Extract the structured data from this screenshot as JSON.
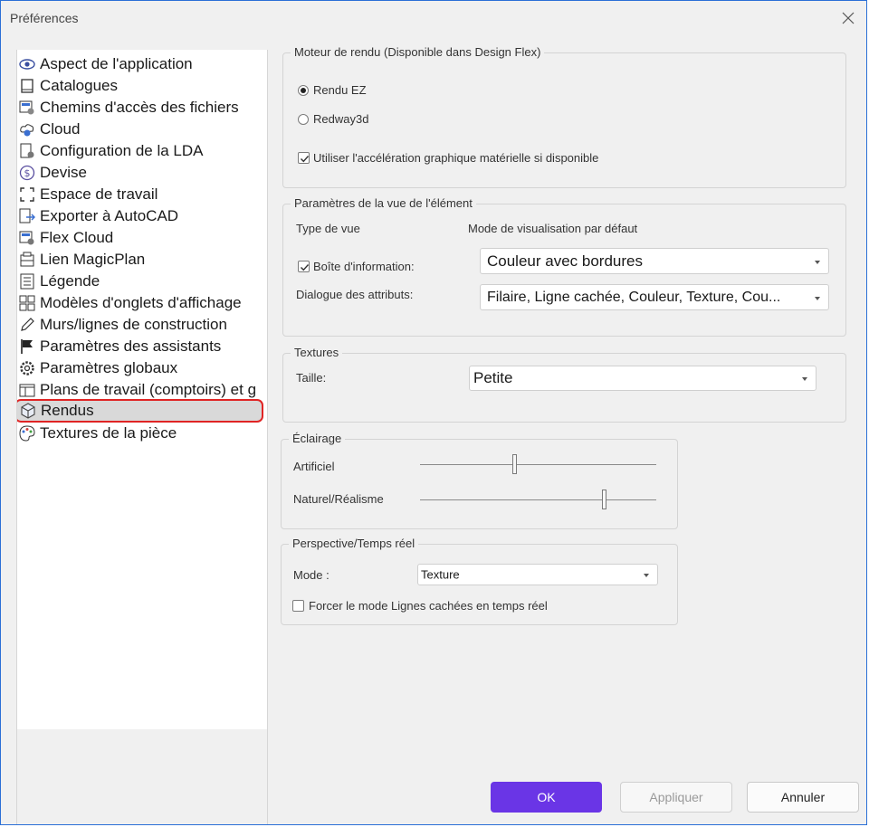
{
  "window": {
    "title": "Préférences"
  },
  "tree": {
    "items": [
      {
        "label": "Aspect de l'application",
        "icon": "eye-icon"
      },
      {
        "label": "Catalogues",
        "icon": "book-icon"
      },
      {
        "label": "Chemins d'accès des fichiers",
        "icon": "folder-gear-icon"
      },
      {
        "label": "Cloud",
        "icon": "cloud-gear-icon"
      },
      {
        "label": "Configuration de la LDA",
        "icon": "document-gear-icon"
      },
      {
        "label": "Devise",
        "icon": "currency-icon"
      },
      {
        "label": "Espace de travail",
        "icon": "workspace-frame-icon"
      },
      {
        "label": "Exporter à AutoCAD",
        "icon": "export-icon"
      },
      {
        "label": "Flex Cloud",
        "icon": "flex-cloud-icon"
      },
      {
        "label": "Lien MagicPlan",
        "icon": "magicplan-icon"
      },
      {
        "label": "Légende",
        "icon": "legend-icon"
      },
      {
        "label": "Modèles d'onglets d'affichage",
        "icon": "tabs-template-icon"
      },
      {
        "label": "Murs/lignes de construction",
        "icon": "pencil-icon"
      },
      {
        "label": "Paramètres des assistants",
        "icon": "flag-icon"
      },
      {
        "label": "Paramètres globaux",
        "icon": "gear-icon"
      },
      {
        "label": "Plans de travail (comptoirs) et g",
        "icon": "countertop-icon"
      },
      {
        "label": "Rendus",
        "icon": "cube-icon"
      },
      {
        "label": "Textures de la pièce",
        "icon": "palette-icon"
      }
    ],
    "selected": "Rendus"
  },
  "render_engine": {
    "title": "Moteur de rendu (Disponible dans Design Flex)",
    "option1": "Rendu EZ",
    "option2": "Redway3d",
    "selected": "Rendu EZ",
    "hw_accel_label": "Utiliser l'accélération graphique matérielle si disponible",
    "hw_accel_checked": true
  },
  "view_params": {
    "title": "Paramètres de la vue de l'élément",
    "col_view_type": "Type de vue",
    "col_default_mode": "Mode de visualisation par défaut",
    "info_box_label": "Boîte d'information:",
    "info_box_checked": true,
    "info_box_value": "Couleur avec bordures",
    "attr_dialog_label": "Dialogue des attributs:",
    "attr_dialog_value": "Filaire, Ligne cachée, Couleur, Texture, Cou..."
  },
  "textures": {
    "title": "Textures",
    "size_label": "Taille:",
    "size_value": "Petite"
  },
  "lighting": {
    "title": "Éclairage",
    "artificial_label": "Artificiel",
    "artificial_level": 0.4,
    "natural_label": "Naturel/Réalisme",
    "natural_level": 0.8
  },
  "perspective": {
    "title": "Perspective/Temps réel",
    "mode_label": "Mode :",
    "mode_value": "Texture",
    "force_hidden_label": "Forcer le mode Lignes cachées en temps réel",
    "force_hidden_checked": false
  },
  "buttons": {
    "ok": "OK",
    "apply": "Appliquer",
    "cancel": "Annuler"
  },
  "colors": {
    "accent": "#6a35e6",
    "selection_border": "#e02424",
    "window_border": "#2b6fd6"
  }
}
